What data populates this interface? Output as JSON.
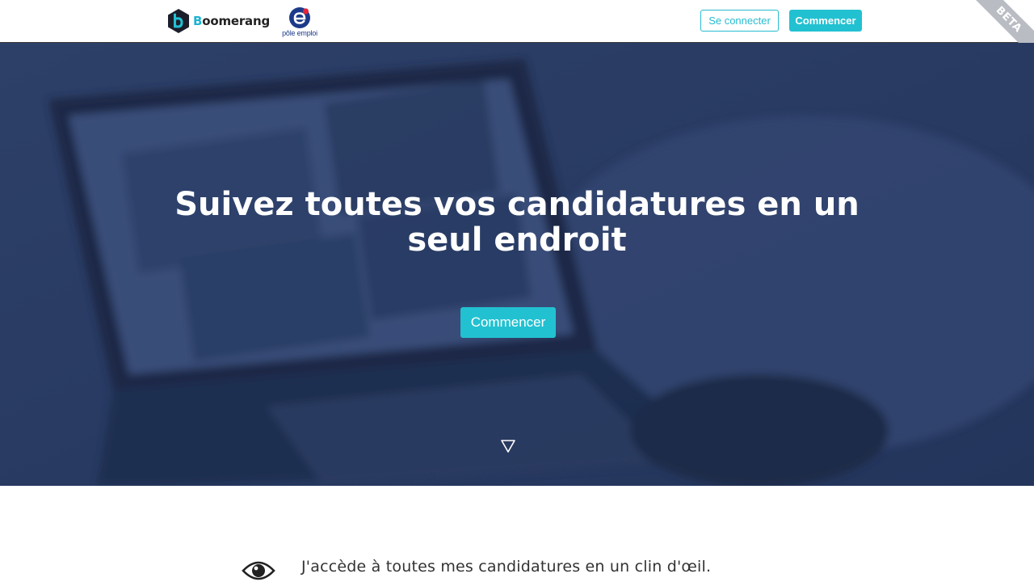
{
  "header": {
    "brand": {
      "initial": "B",
      "rest": "oomerang",
      "accent_color": "#1fb3d2"
    },
    "partner": {
      "text": "pôle emploi"
    },
    "login_label": "Se connecter",
    "start_label": "Commencer",
    "ribbon_label": "BETA"
  },
  "hero": {
    "title": "Suivez toutes vos candidatures en un seul endroit",
    "cta_label": "Commencer",
    "overlay_color": "#26375e"
  },
  "feature": {
    "icon": "eye-icon",
    "text": "J'accède à toutes mes candidatures en un clin d'œil."
  },
  "colors": {
    "accent": "#22c1d1"
  }
}
